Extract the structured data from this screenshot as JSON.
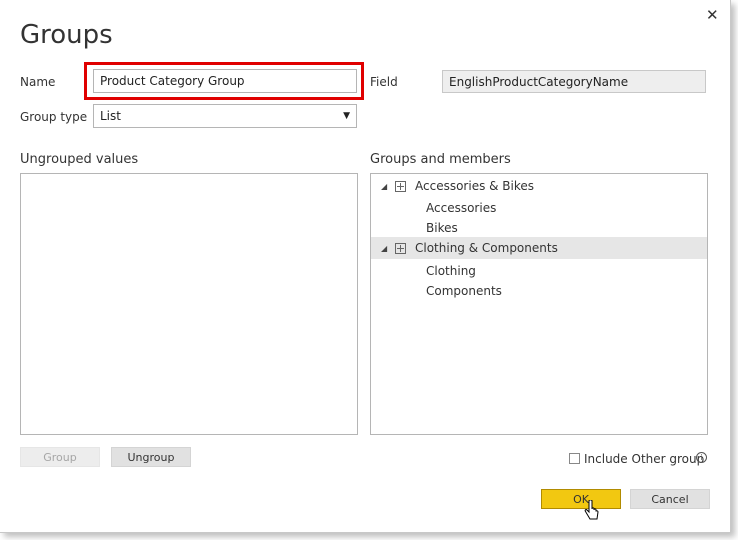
{
  "dialog": {
    "title": "Groups",
    "close_icon": "close-icon"
  },
  "form": {
    "name_label": "Name",
    "name_value": "Product Category Group",
    "field_label": "Field",
    "field_value": "EnglishProductCategoryName",
    "group_type_label": "Group type",
    "group_type_value": "List"
  },
  "ungrouped": {
    "title": "Ungrouped values",
    "items": []
  },
  "groups": {
    "title": "Groups and members",
    "items": [
      {
        "name": "Accessories & Bikes",
        "members": [
          "Accessories",
          "Bikes"
        ]
      },
      {
        "name": "Clothing & Components",
        "members": [
          "Clothing",
          "Components"
        ]
      }
    ]
  },
  "buttons": {
    "group": "Group",
    "ungroup": "Ungroup",
    "ok": "OK",
    "cancel": "Cancel"
  },
  "options": {
    "include_other_label": "Include Other group",
    "include_other_checked": false
  },
  "colors": {
    "highlight": "#e00000",
    "ok_button": "#f2c811"
  }
}
